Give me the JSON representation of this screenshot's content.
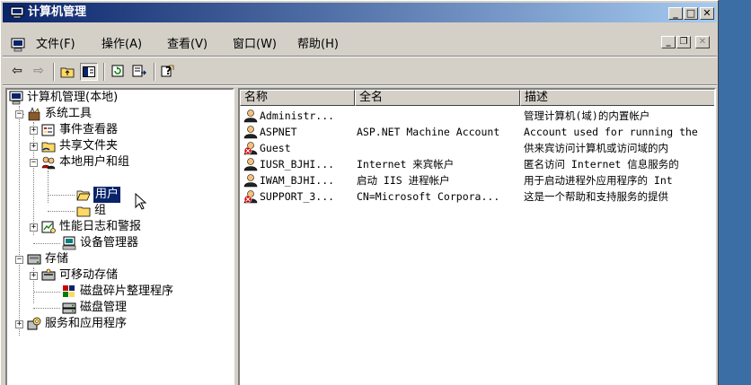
{
  "window": {
    "title": "计算机管理"
  },
  "menubar": {
    "items": [
      "文件(F)",
      "操作(A)",
      "查看(V)",
      "窗口(W)",
      "帮助(H)"
    ]
  },
  "toolbar": {
    "buttons": [
      "back-arrow",
      "forward-arrow",
      "up-folder",
      "show-hide-tree",
      "refresh",
      "export-list",
      "help"
    ]
  },
  "tree": {
    "root": "计算机管理(本地)",
    "system_tools": "系统工具",
    "event_viewer": "事件查看器",
    "shared_folders": "共享文件夹",
    "local_users_groups": "本地用户和组",
    "users": "用户",
    "groups": "组",
    "perf_logs": "性能日志和警报",
    "device_manager": "设备管理器",
    "storage": "存储",
    "removable_storage": "可移动存储",
    "defrag": "磁盘碎片整理程序",
    "disk_mgmt": "磁盘管理",
    "services_apps": "服务和应用程序"
  },
  "list": {
    "columns": [
      "名称",
      "全名",
      "描述"
    ],
    "rows": [
      {
        "name": "Administr...",
        "fullname": "",
        "desc": "管理计算机(域)的内置帐户",
        "disabled": false
      },
      {
        "name": "ASPNET",
        "fullname": "ASP.NET Machine Account",
        "desc": "Account used for running the",
        "disabled": false
      },
      {
        "name": "Guest",
        "fullname": "",
        "desc": "供来宾访问计算机或访问域的内",
        "disabled": true
      },
      {
        "name": "IUSR_BJHI...",
        "fullname": "Internet 来宾帐户",
        "desc": "匿名访问 Internet 信息服务的",
        "disabled": false
      },
      {
        "name": "IWAM_BJHI...",
        "fullname": "启动 IIS 进程帐户",
        "desc": "用于启动进程外应用程序的 Int",
        "disabled": false
      },
      {
        "name": "SUPPORT_3...",
        "fullname": "CN=Microsoft Corpora...",
        "desc": "这是一个帮助和支持服务的提供",
        "disabled": true
      }
    ]
  },
  "colors": {
    "title_start": "#0a246a",
    "title_end": "#a6caf0",
    "face": "#d4d0c8",
    "selection": "#0a246a",
    "desktop": "#3a6ea5"
  }
}
